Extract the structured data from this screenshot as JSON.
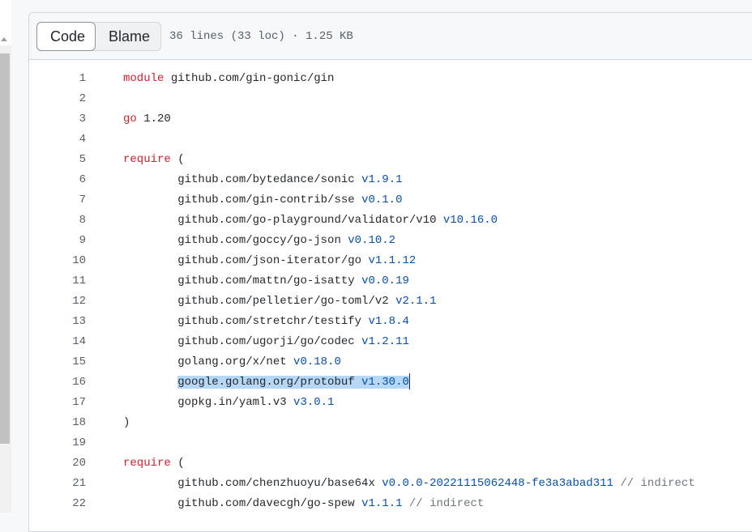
{
  "tabs": {
    "code": "Code",
    "blame": "Blame"
  },
  "file_info": "36 lines (33 loc) · 1.25 KB",
  "lines": [
    {
      "n": "1",
      "kw": "module",
      "text": " github.com/gin-gonic/gin",
      "ver": "",
      "comment": ""
    },
    {
      "n": "2",
      "kw": "",
      "text": "",
      "ver": "",
      "comment": ""
    },
    {
      "n": "3",
      "kw": "go",
      "text": " 1.20",
      "ver": "",
      "comment": ""
    },
    {
      "n": "4",
      "kw": "",
      "text": "",
      "ver": "",
      "comment": ""
    },
    {
      "n": "5",
      "kw": "require",
      "text": " (",
      "ver": "",
      "comment": ""
    },
    {
      "n": "6",
      "kw": "",
      "text": "\tgithub.com/bytedance/sonic ",
      "ver": "v1.9.1",
      "comment": ""
    },
    {
      "n": "7",
      "kw": "",
      "text": "\tgithub.com/gin-contrib/sse ",
      "ver": "v0.1.0",
      "comment": ""
    },
    {
      "n": "8",
      "kw": "",
      "text": "\tgithub.com/go-playground/validator/v10 ",
      "ver": "v10.16.0",
      "comment": ""
    },
    {
      "n": "9",
      "kw": "",
      "text": "\tgithub.com/goccy/go-json ",
      "ver": "v0.10.2",
      "comment": ""
    },
    {
      "n": "10",
      "kw": "",
      "text": "\tgithub.com/json-iterator/go ",
      "ver": "v1.1.12",
      "comment": ""
    },
    {
      "n": "11",
      "kw": "",
      "text": "\tgithub.com/mattn/go-isatty ",
      "ver": "v0.0.19",
      "comment": ""
    },
    {
      "n": "12",
      "kw": "",
      "text": "\tgithub.com/pelletier/go-toml/v2 ",
      "ver": "v2.1.1",
      "comment": ""
    },
    {
      "n": "13",
      "kw": "",
      "text": "\tgithub.com/stretchr/testify ",
      "ver": "v1.8.4",
      "comment": ""
    },
    {
      "n": "14",
      "kw": "",
      "text": "\tgithub.com/ugorji/go/codec ",
      "ver": "v1.2.11",
      "comment": ""
    },
    {
      "n": "15",
      "kw": "",
      "text": "\tgolang.org/x/net ",
      "ver": "v0.18.0",
      "comment": ""
    },
    {
      "n": "16",
      "kw": "",
      "text": "\tgoogle.golang.org/protobuf ",
      "ver": "v1.30.0",
      "comment": "",
      "selected": true
    },
    {
      "n": "17",
      "kw": "",
      "text": "\tgopkg.in/yaml.v3 ",
      "ver": "v3.0.1",
      "comment": ""
    },
    {
      "n": "18",
      "kw": "",
      "text": ")",
      "ver": "",
      "comment": ""
    },
    {
      "n": "19",
      "kw": "",
      "text": "",
      "ver": "",
      "comment": ""
    },
    {
      "n": "20",
      "kw": "require",
      "text": " (",
      "ver": "",
      "comment": ""
    },
    {
      "n": "21",
      "kw": "",
      "text": "\tgithub.com/chenzhuoyu/base64x ",
      "ver": "v0.0.0-20221115062448-fe3a3abad311",
      "comment": " // indirect"
    },
    {
      "n": "22",
      "kw": "",
      "text": "\tgithub.com/davecgh/go-spew ",
      "ver": "v1.1.1",
      "comment": " // indirect"
    }
  ],
  "colors": {
    "keyword": "#cf222e",
    "version": "#0550ae",
    "selection": "#b6d7f5"
  }
}
